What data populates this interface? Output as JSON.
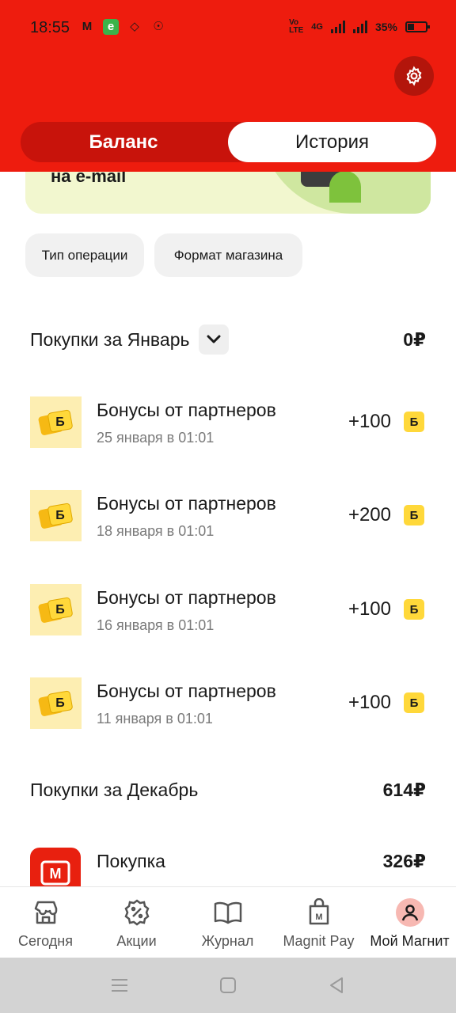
{
  "status_bar": {
    "time": "18:55",
    "battery": "35%",
    "network": "4G"
  },
  "tabs": {
    "balance": "Баланс",
    "history": "История",
    "active": "history"
  },
  "banner": {
    "text": "на e-mail"
  },
  "filters": [
    {
      "label": "Тип операции"
    },
    {
      "label": "Формат магазина"
    }
  ],
  "sections": [
    {
      "title": "Покупки за Январь",
      "amount": "0₽",
      "transactions": [
        {
          "title": "Бонусы от партнеров",
          "date": "25 января в 01:01",
          "amount": "+100",
          "badge": "Б"
        },
        {
          "title": "Бонусы от партнеров",
          "date": "18 января в 01:01",
          "amount": "+200",
          "badge": "Б"
        },
        {
          "title": "Бонусы от партнеров",
          "date": "16 января в 01:01",
          "amount": "+100",
          "badge": "Б"
        },
        {
          "title": "Бонусы от партнеров",
          "date": "11 января в 01:01",
          "amount": "+100",
          "badge": "Б"
        }
      ]
    },
    {
      "title": "Покупки за Декабрь",
      "amount": "614₽",
      "transactions": [
        {
          "title": "Покупка",
          "amount": "326₽"
        }
      ]
    }
  ],
  "bottom_nav": [
    {
      "label": "Сегодня",
      "icon": "store-icon"
    },
    {
      "label": "Акции",
      "icon": "discount-icon"
    },
    {
      "label": "Журнал",
      "icon": "book-icon"
    },
    {
      "label": "Magnit Pay",
      "icon": "wallet-icon"
    },
    {
      "label": "Мой Магнит",
      "icon": "profile-icon",
      "active": true
    }
  ],
  "colors": {
    "brand_red": "#ee1c0e",
    "bonus_yellow": "#ffd83a",
    "chip_gray": "#f1f1f1"
  }
}
